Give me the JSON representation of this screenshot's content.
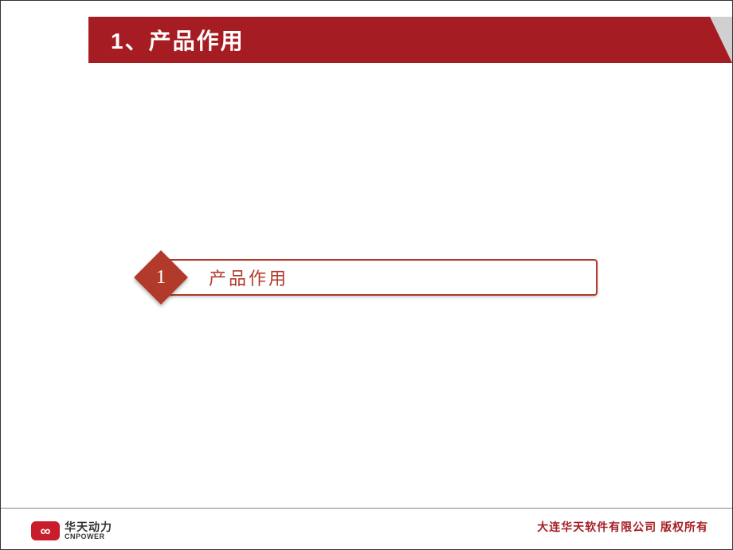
{
  "header": {
    "title": "1、产品作用"
  },
  "content": {
    "badge_number": "1",
    "item_text": "产品作用"
  },
  "footer": {
    "logo_cn": "华天动力",
    "logo_en": "CNPOWER",
    "copyright": "大连华天软件有限公司  版权所有"
  }
}
